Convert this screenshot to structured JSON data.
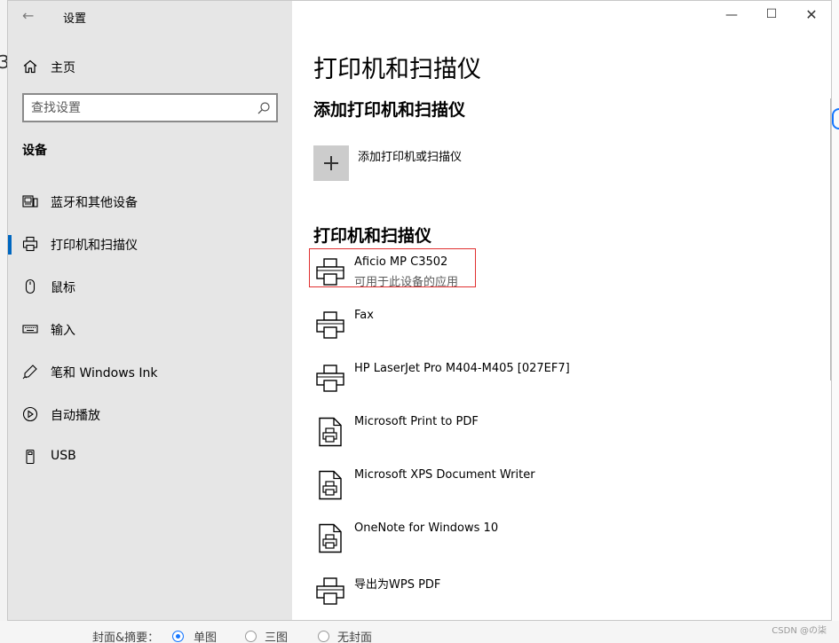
{
  "window": {
    "app_title": "设置"
  },
  "sidebar": {
    "home_label": "主页",
    "search_placeholder": "查找设置",
    "section_heading": "设备",
    "items": [
      {
        "label": "蓝牙和其他设备",
        "icon": "keyboard-device-icon",
        "selected": false
      },
      {
        "label": "打印机和扫描仪",
        "icon": "printer-icon",
        "selected": true
      },
      {
        "label": "鼠标",
        "icon": "mouse-icon",
        "selected": false
      },
      {
        "label": "输入",
        "icon": "keyboard-icon",
        "selected": false
      },
      {
        "label": "笔和 Windows Ink",
        "icon": "pen-icon",
        "selected": false
      },
      {
        "label": "自动播放",
        "icon": "autoplay-icon",
        "selected": false
      },
      {
        "label": "USB",
        "icon": "usb-icon",
        "selected": false
      }
    ]
  },
  "main": {
    "title": "打印机和扫描仪",
    "add_section_title": "添加打印机和扫描仪",
    "add_button_label": "添加打印机或扫描仪",
    "list_section_title": "打印机和扫描仪",
    "printers": [
      {
        "name": "Aficio MP C3502",
        "status": "可用于此设备的应用",
        "icon": "printer-icon"
      },
      {
        "name": "Fax",
        "status": "",
        "icon": "printer-icon"
      },
      {
        "name": "HP LaserJet Pro M404-M405 [027EF7]",
        "status": "",
        "icon": "printer-icon"
      },
      {
        "name": "Microsoft Print to PDF",
        "status": "",
        "icon": "document-printer-icon"
      },
      {
        "name": "Microsoft XPS Document Writer",
        "status": "",
        "icon": "document-printer-icon"
      },
      {
        "name": "OneNote for Windows 10",
        "status": "",
        "icon": "document-printer-icon"
      },
      {
        "name": "导出为WPS PDF",
        "status": "",
        "icon": "printer-icon"
      }
    ]
  },
  "background": {
    "left_fragment": "3",
    "bottom_fragments": [
      "封面&摘要：",
      "单图",
      "三图",
      "无封面"
    ],
    "watermark": "CSDN @の柒"
  },
  "colors": {
    "accent": "#0067c0",
    "highlight_box": "#e03030",
    "sidebar_bg": "#e6e6e6"
  }
}
